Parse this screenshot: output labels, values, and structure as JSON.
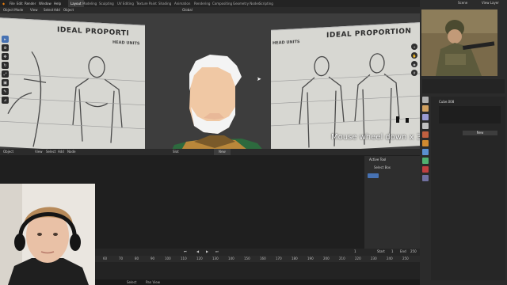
{
  "topbar": {
    "menus": [
      "File",
      "Edit",
      "Render",
      "Window",
      "Help"
    ],
    "workspaces": [
      "Layout",
      "Modeling",
      "Sculpting",
      "UV Editing",
      "Texture Paint",
      "Shading",
      "Animation",
      "Rendering",
      "Compositing",
      "Geometry Nodes",
      "Scripting"
    ],
    "active_workspace": "Layout",
    "scene_label": "Scene",
    "view_layer_label": "View Layer"
  },
  "header": {
    "mode": "Object Mode",
    "menus": [
      "View",
      "Select",
      "Add",
      "Object"
    ],
    "transform": "Global"
  },
  "viewport": {
    "ref_left": {
      "title": "IDEAL PROPORTI",
      "sub": "HEAD UNITS"
    },
    "ref_right": {
      "title": "IDEAL PROPORTION",
      "sub": "HEAD UNITS"
    },
    "overlay_text": "Mouse wheel down x 3"
  },
  "editor_header": {
    "mode": "Object",
    "menus": [
      "View",
      "Select",
      "Add",
      "Node"
    ],
    "slot": "Slot",
    "new_label": "New"
  },
  "active_tool": {
    "title": "Active Tool",
    "item": "Select Box"
  },
  "timeline": {
    "frames": [
      "60",
      "70",
      "80",
      "90",
      "100",
      "110",
      "120",
      "130",
      "140",
      "150",
      "160",
      "170",
      "180",
      "190",
      "200",
      "210",
      "220",
      "230",
      "240",
      "250"
    ],
    "start_label": "Start",
    "start_value": "1",
    "end_label": "End",
    "end_value": "250",
    "current": "1"
  },
  "statusbar": {
    "items": [
      "Select",
      "Pan View"
    ],
    "version": "2.93.4"
  },
  "outliner": {
    "item": "Cube.008"
  },
  "props": {
    "object_name": "Cube.008",
    "new_label": "New"
  },
  "colors": {
    "accent": "#4772b3",
    "viewport_bg": "#3d3d3d",
    "skin": "#f0c8a4",
    "hair": "#f4f4f4",
    "jacket": "#b9873a",
    "shirt": "#2d6a3e"
  }
}
